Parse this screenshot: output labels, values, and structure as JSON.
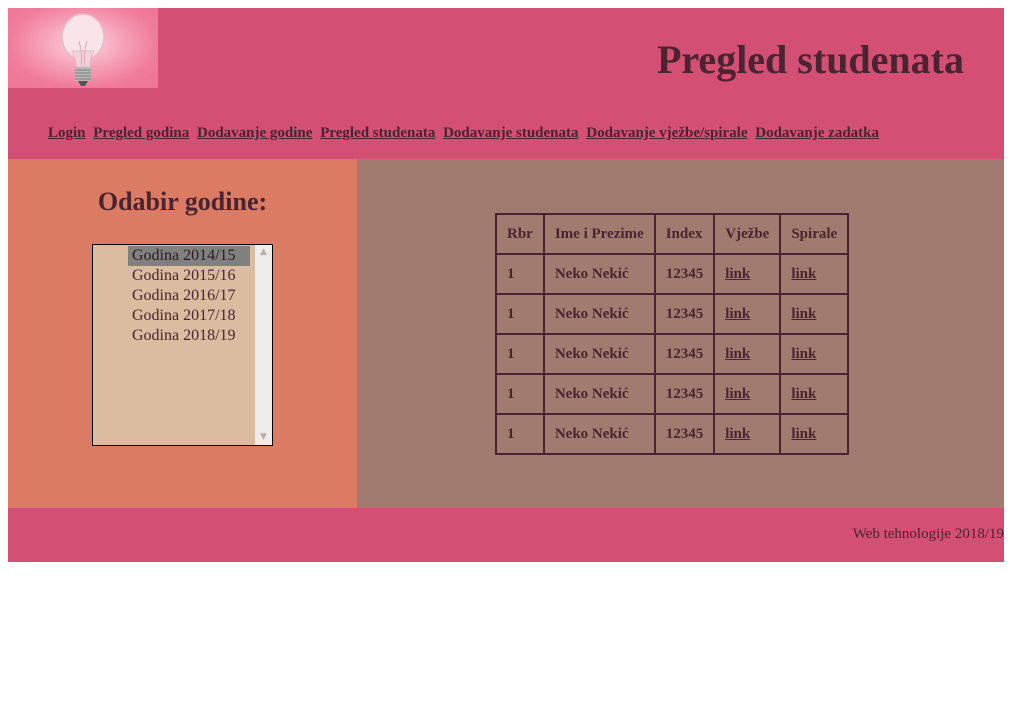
{
  "header": {
    "title": "Pregled studenata",
    "logo_icon": "lightbulb-icon"
  },
  "nav": {
    "items": [
      {
        "label": "Login"
      },
      {
        "label": "Pregled godina"
      },
      {
        "label": "Dodavanje godine"
      },
      {
        "label": "Pregled studenata"
      },
      {
        "label": "Dodavanje studenata"
      },
      {
        "label": "Dodavanje vježbe/spirale"
      },
      {
        "label": "Dodavanje zadatka"
      }
    ]
  },
  "year_select": {
    "heading": "Odabir godine:",
    "options": [
      "Godina 2014/15",
      "Godina 2015/16",
      "Godina 2016/17",
      "Godina 2017/18",
      "Godina 2018/19"
    ],
    "selected": "Godina 2014/15"
  },
  "students_table": {
    "headers": [
      "Rbr",
      "Ime i Prezime",
      "Index",
      "Vježbe",
      "Spirale"
    ],
    "rows": [
      {
        "rbr": "1",
        "name": "Neko Nekić",
        "index": "12345",
        "vjezbe": "link",
        "spirale": "link"
      },
      {
        "rbr": "1",
        "name": "Neko Nekić",
        "index": "12345",
        "vjezbe": "link",
        "spirale": "link"
      },
      {
        "rbr": "1",
        "name": "Neko Nekić",
        "index": "12345",
        "vjezbe": "link",
        "spirale": "link"
      },
      {
        "rbr": "1",
        "name": "Neko Nekić",
        "index": "12345",
        "vjezbe": "link",
        "spirale": "link"
      },
      {
        "rbr": "1",
        "name": "Neko Nekić",
        "index": "12345",
        "vjezbe": "link",
        "spirale": "link"
      }
    ]
  },
  "footer": {
    "text": "Web tehnologije 2018/19"
  },
  "colors": {
    "header_bg": "#d34f73",
    "left_panel_bg": "#db7b63",
    "right_panel_bg": "#a27b70",
    "text": "#4a2430"
  }
}
